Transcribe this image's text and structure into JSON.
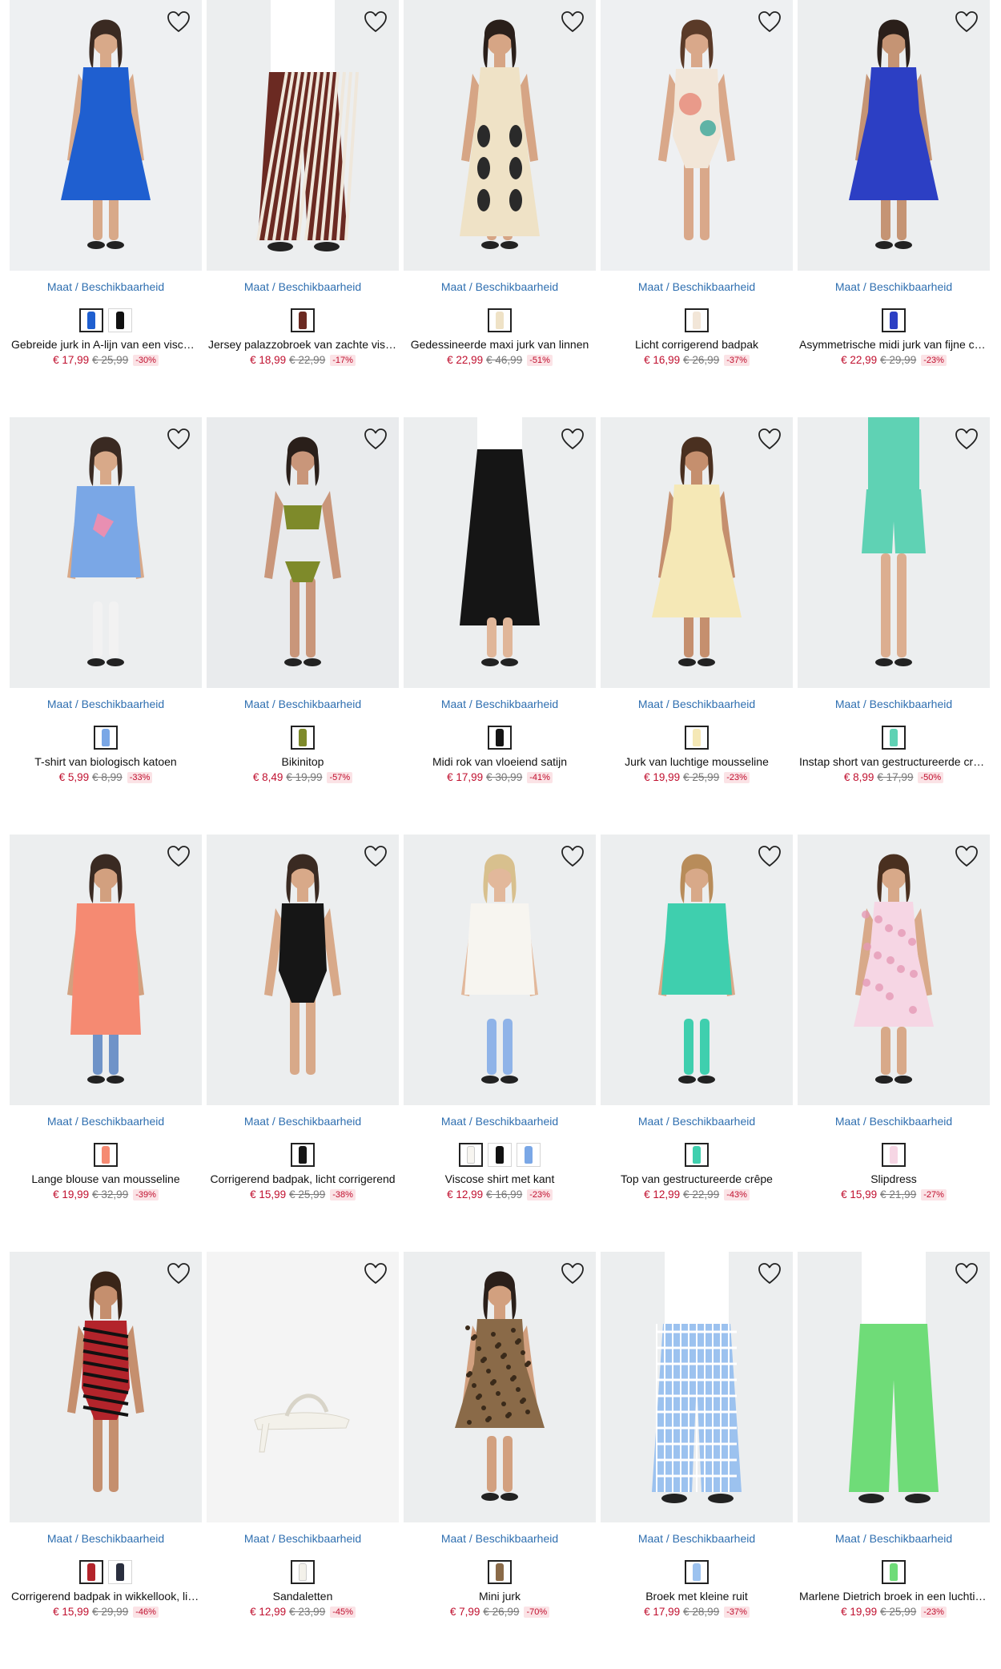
{
  "size_link": {
    "maat": "Maat",
    "sep": "/",
    "beschikbaarheid": "Beschikbaarheid"
  },
  "colors": {
    "sale": "#c0102f",
    "link": "#2f6fb0"
  },
  "products": [
    {
      "name": "Gebreide jurk in A-lijn van een viscose-mix",
      "price": "€ 17,99",
      "old": "€ 25,99",
      "discount": "-30%",
      "icon": "blue-dress",
      "main": "#1f5fd0",
      "bg": "#eef0f2",
      "skin": "#d8a989",
      "hair": "#3a2a22",
      "swatches": [
        "#1f5fd0",
        "#111111"
      ]
    },
    {
      "name": "Jersey palazzobroek van zachte viscose",
      "price": "€ 18,99",
      "old": "€ 22,99",
      "discount": "-17%",
      "icon": "striped-trousers",
      "main": "#6b2a22",
      "bg": "#eceeef",
      "skin": "#c99a7b",
      "hair": "#2f211a",
      "swatches": [
        "#6b2a22"
      ]
    },
    {
      "name": "Gedessineerde maxi jurk van linnen",
      "price": "€ 22,99",
      "old": "€ 46,99",
      "discount": "-51%",
      "icon": "maxi-dress",
      "main": "#efe2c6",
      "bg": "#eceeef",
      "skin": "#d6a585",
      "hair": "#2a1f1a",
      "swatches": [
        "#efe2c6"
      ]
    },
    {
      "name": "Licht corrigerend badpak",
      "price": "€ 16,99",
      "old": "€ 26,99",
      "discount": "-37%",
      "icon": "swimsuit",
      "main": "#f2e6d8",
      "bg": "#eef0f2",
      "skin": "#d9a88a",
      "hair": "#5a3a28",
      "swatches": [
        "#f2e6d8"
      ]
    },
    {
      "name": "Asymmetrische midi jurk van fijne crêpe",
      "price": "€ 22,99",
      "old": "€ 29,99",
      "discount": "-23%",
      "icon": "midi-dress",
      "main": "#2c3fc4",
      "bg": "#eceeef",
      "skin": "#c59474",
      "hair": "#2a1f1a",
      "swatches": [
        "#2c3fc4"
      ]
    },
    {
      "name": "T-shirt van biologisch katoen",
      "price": "€ 5,99",
      "old": "€ 8,99",
      "discount": "-33%",
      "icon": "tshirt",
      "main": "#7aa7e6",
      "bg": "#eceeef",
      "skin": "#d8a989",
      "hair": "#3a2a22",
      "swatches": [
        "#7aa7e6"
      ]
    },
    {
      "name": "Bikinitop",
      "price": "€ 8,49",
      "old": "€ 19,99",
      "discount": "-57%",
      "icon": "bikini",
      "main": "#7e8a2a",
      "bg": "#e9ebed",
      "skin": "#c9967a",
      "hair": "#2a1f1a",
      "swatches": [
        "#7e8a2a"
      ]
    },
    {
      "name": "Midi rok van vloeiend satijn",
      "price": "€ 17,99",
      "old": "€ 30,99",
      "discount": "-41%",
      "icon": "skirt",
      "main": "#151515",
      "bg": "#eceeef",
      "skin": "#e0b699",
      "hair": "#2a1f1a",
      "swatches": [
        "#151515"
      ]
    },
    {
      "name": "Jurk van luchtige mousseline",
      "price": "€ 19,99",
      "old": "€ 25,99",
      "discount": "-23%",
      "icon": "light-dress",
      "main": "#f5e8b6",
      "bg": "#eceeef",
      "skin": "#c58f6e",
      "hair": "#4a3020",
      "swatches": [
        "#f5e8b6"
      ]
    },
    {
      "name": "Instap short van gestructureerde crêpe",
      "price": "€ 8,99",
      "old": "€ 17,99",
      "discount": "-50%",
      "icon": "shorts",
      "main": "#5fd2b4",
      "bg": "#eceeef",
      "skin": "#dcae90",
      "hair": "#3a2a22",
      "swatches": [
        "#5fd2b4"
      ]
    },
    {
      "name": "Lange blouse van mousseline",
      "price": "€ 19,99",
      "old": "€ 32,99",
      "discount": "-39%",
      "icon": "blouse",
      "main": "#f58a72",
      "bg": "#eceeef",
      "skin": "#d2a07f",
      "hair": "#3a2a22",
      "swatches": [
        "#f58a72"
      ]
    },
    {
      "name": "Corrigerend badpak, licht corrigerend",
      "price": "€ 15,99",
      "old": "€ 25,99",
      "discount": "-38%",
      "icon": "black-swimsuit",
      "main": "#161616",
      "bg": "#eceeef",
      "skin": "#d8a989",
      "hair": "#3a2a22",
      "swatches": [
        "#161616"
      ]
    },
    {
      "name": "Viscose shirt met kant",
      "price": "€ 12,99",
      "old": "€ 16,99",
      "discount": "-23%",
      "icon": "lace-shirt",
      "main": "#f7f5f0",
      "bg": "#eceeef",
      "skin": "#e2b89b",
      "hair": "#d8c08e",
      "swatches": [
        "#f7f5f0",
        "#111111",
        "#7aa7e6"
      ]
    },
    {
      "name": "Top van gestructureerde crêpe",
      "price": "€ 12,99",
      "old": "€ 22,99",
      "discount": "-43%",
      "icon": "mint-top",
      "main": "#3fcfae",
      "bg": "#eceeef",
      "skin": "#d8a989",
      "hair": "#b88c5a",
      "swatches": [
        "#3fcfae"
      ]
    },
    {
      "name": "Slipdress",
      "price": "€ 15,99",
      "old": "€ 21,99",
      "discount": "-27%",
      "icon": "slipdress",
      "main": "#f6d6e4",
      "bg": "#eceeef",
      "skin": "#d8a989",
      "hair": "#4a3020",
      "swatches": [
        "#f6d6e4"
      ]
    },
    {
      "name": "Corrigerend badpak in wikkellook, licht corrigerend",
      "price": "€ 15,99",
      "old": "€ 29,99",
      "discount": "-46%",
      "icon": "striped-swimsuit",
      "main": "#b3242b",
      "bg": "#eceeef",
      "skin": "#c58f6e",
      "hair": "#3a2518",
      "swatches": [
        "#b3242b",
        "#2a2f3f"
      ]
    },
    {
      "name": "Sandaletten",
      "price": "€ 12,99",
      "old": "€ 23,99",
      "discount": "-45%",
      "icon": "sandal",
      "main": "#f3f1ea",
      "bg": "#f4f4f4",
      "skin": "#d8a989",
      "hair": "#3a2a22",
      "swatches": [
        "#f3f1ea"
      ]
    },
    {
      "name": "Mini jurk",
      "price": "€ 7,99",
      "old": "€ 26,99",
      "discount": "-70%",
      "icon": "leopard-dress",
      "main": "#8a6a48",
      "bg": "#eceeef",
      "skin": "#d2a07f",
      "hair": "#2a1f1a",
      "swatches": [
        "#8a6a48"
      ]
    },
    {
      "name": "Broek met kleine ruit",
      "price": "€ 17,99",
      "old": "€ 28,99",
      "discount": "-37%",
      "icon": "check-trousers",
      "main": "#9cc2ef",
      "bg": "#eceeef",
      "skin": "#e0b699",
      "hair": "#3a2a22",
      "swatches": [
        "#9cc2ef"
      ]
    },
    {
      "name": "Marlene Dietrich broek in een luchtige kwaliteit",
      "price": "€ 19,99",
      "old": "€ 25,99",
      "discount": "-23%",
      "icon": "green-trousers",
      "main": "#6fdc78",
      "bg": "#eceeef",
      "skin": "#d8a989",
      "hair": "#3a2a22",
      "swatches": [
        "#6fdc78"
      ]
    }
  ]
}
